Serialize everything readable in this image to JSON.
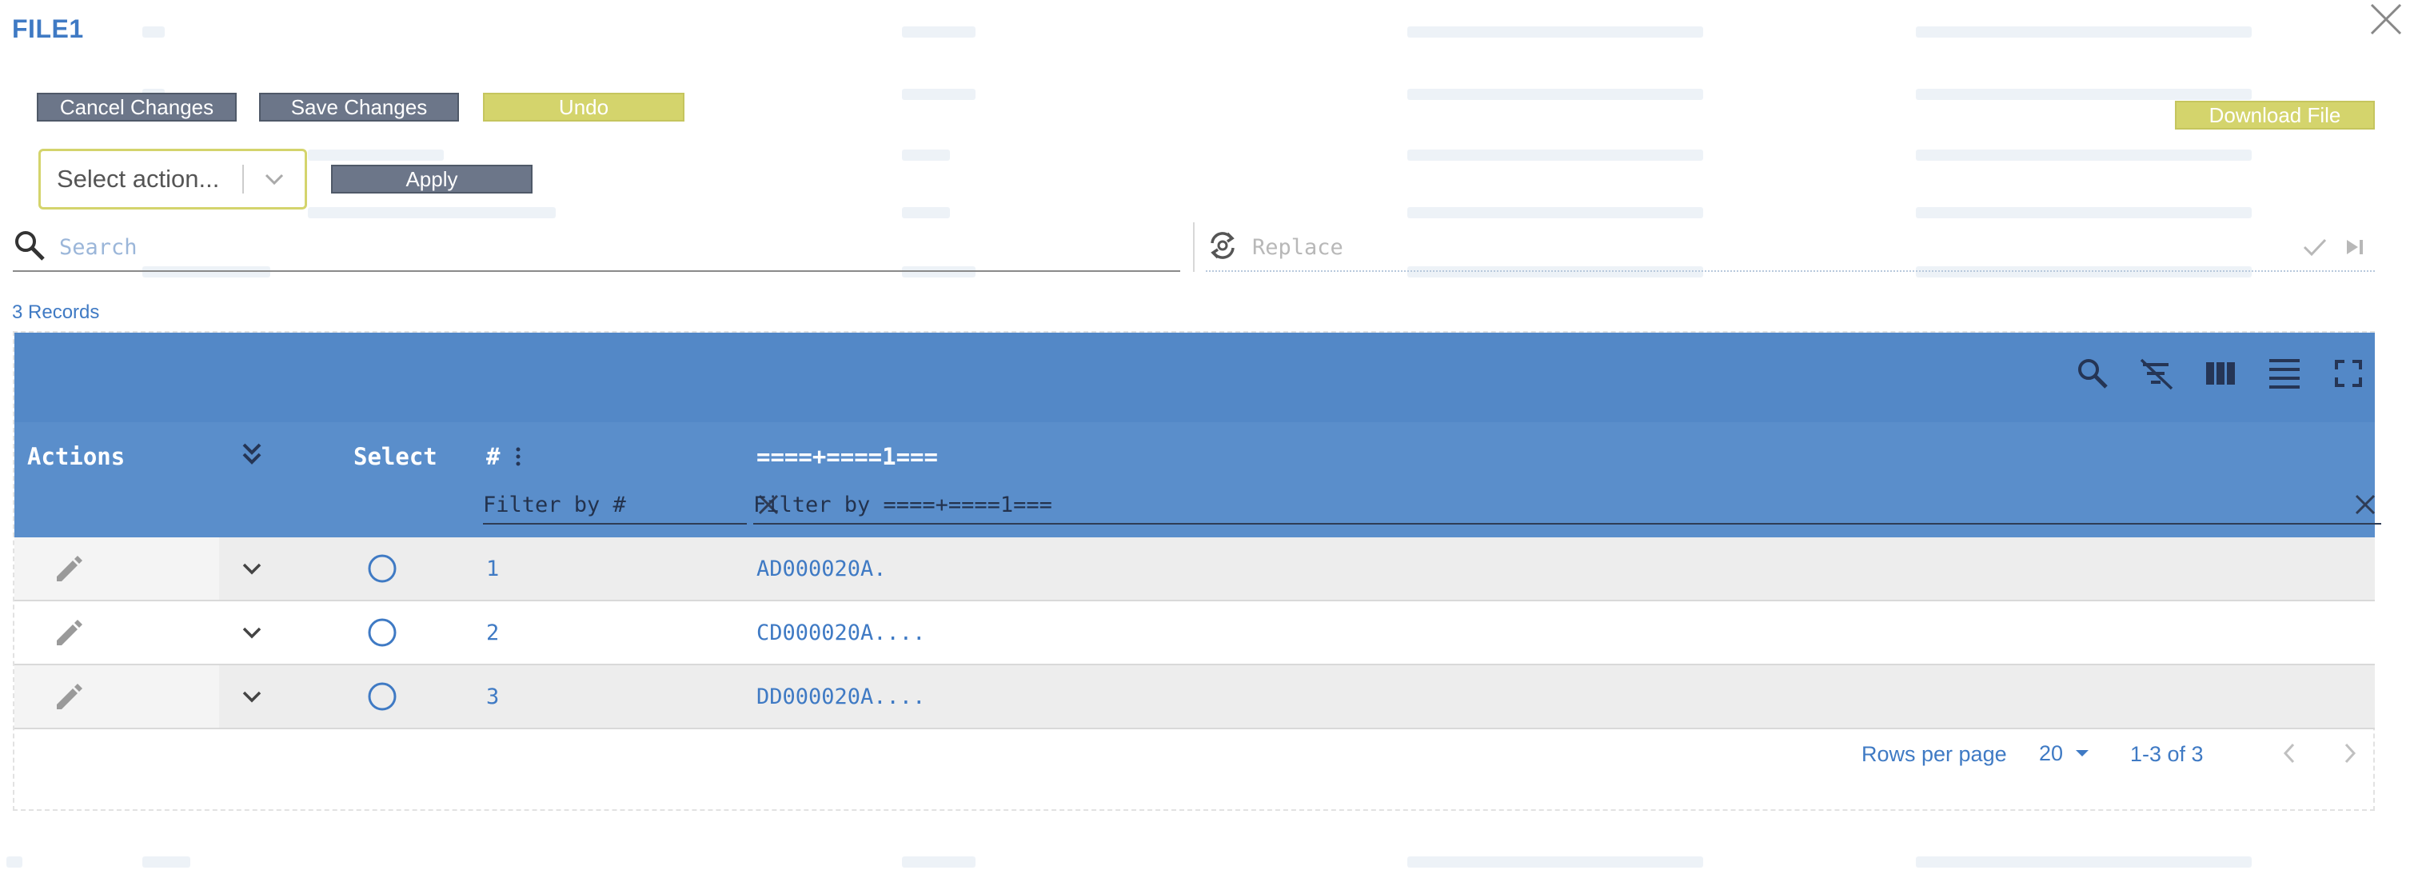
{
  "modal": {
    "title": "FILE1",
    "cancel_label": "Cancel Changes",
    "save_label": "Save Changes",
    "undo_label": "Undo",
    "download_label": "Download File",
    "action_select_value": "Select action...",
    "apply_label": "Apply"
  },
  "search": {
    "placeholder": "Search"
  },
  "replace": {
    "placeholder": "Replace"
  },
  "records_label": "3 Records",
  "table": {
    "columns": {
      "actions": "Actions",
      "select": "Select",
      "number": "#",
      "data": "====+====1==="
    },
    "filters": {
      "number_placeholder": "Filter by #",
      "data_placeholder": "Filter by ====+====1==="
    },
    "rows": [
      {
        "num": "1",
        "value": "AD000020A."
      },
      {
        "num": "2",
        "value": "CD000020A...."
      },
      {
        "num": "3",
        "value": "DD000020A...."
      }
    ]
  },
  "pagination": {
    "rows_per_page_label": "Rows per page",
    "rows_per_page_value": "20",
    "range": "1-3 of 3"
  },
  "colors": {
    "accent_blue": "#3f7ac4",
    "toolbar_blue": "#5388c7",
    "header_blue": "#5a8ecb",
    "button_gray": "#6c7689",
    "button_yellow": "#d4d46c"
  },
  "icons": {
    "close": "close-icon",
    "search": "search-icon",
    "replace": "replace-icon",
    "confirm": "check-icon",
    "replace_next": "skip-next-icon",
    "toolbar": [
      "search-icon",
      "clear-filter-icon",
      "columns-icon",
      "density-icon",
      "fullscreen-icon"
    ],
    "expand_all": "double-chevron-down-icon",
    "edit": "pencil-icon",
    "expand": "chevron-down-icon",
    "select": "radio-circle-icon",
    "column_menu": "vertical-dots-icon"
  }
}
